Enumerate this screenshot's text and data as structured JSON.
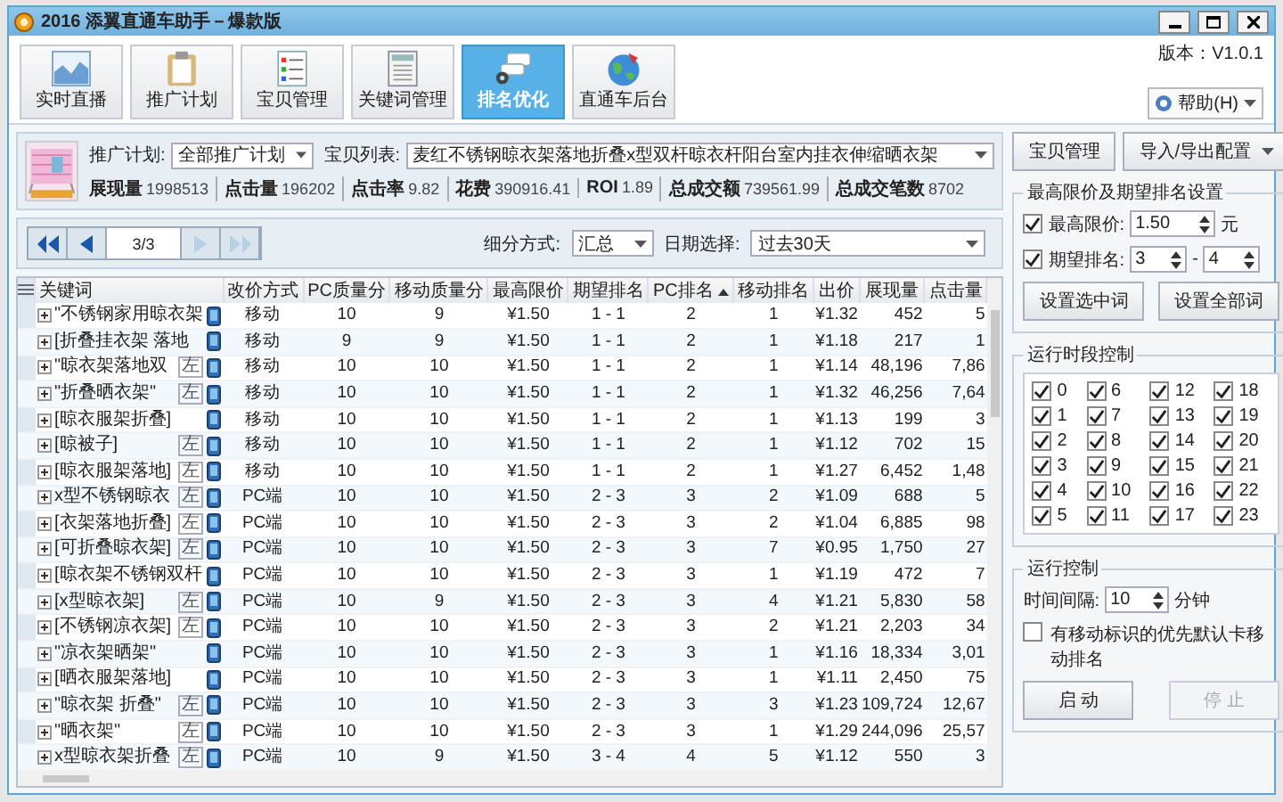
{
  "window": {
    "title": "2016 添翼直通车助手－爆款版",
    "version": "版本：V1.0.1",
    "help": "帮助(H)"
  },
  "toolbar": [
    {
      "label": "实时直播",
      "selected": false
    },
    {
      "label": "推广计划",
      "selected": false
    },
    {
      "label": "宝贝管理",
      "selected": false
    },
    {
      "label": "关键词管理",
      "selected": false
    },
    {
      "label": "排名优化",
      "selected": true
    },
    {
      "label": "直通车后台",
      "selected": false
    }
  ],
  "product": {
    "plan_label": "推广计划:",
    "plan": "全部推广计划",
    "item_label": "宝贝列表:",
    "item": "麦红不锈钢晾衣架落地折叠x型双杆晾衣杆阳台室内挂衣伸缩晒衣架",
    "stats": [
      {
        "label": "展现量",
        "value": "1998513"
      },
      {
        "label": "点击量",
        "value": "196202"
      },
      {
        "label": "点击率",
        "value": "9.82"
      },
      {
        "label": "花费",
        "value": "390916.41"
      },
      {
        "label": "ROI",
        "value": "1.89"
      },
      {
        "label": "总成交额",
        "value": "739561.99"
      },
      {
        "label": "总成交笔数",
        "value": "8702"
      }
    ]
  },
  "pager": {
    "page": "3/3",
    "buttons": [
      {
        "kind": "first",
        "disabled": false
      },
      {
        "kind": "prev",
        "disabled": false
      },
      {
        "kind": "next",
        "disabled": true
      },
      {
        "kind": "last",
        "disabled": true
      }
    ]
  },
  "filters": [
    {
      "label": "细分方式:",
      "value": "汇总"
    },
    {
      "label": "日期选择:",
      "value": "过去30天"
    }
  ],
  "table": {
    "columns": [
      {
        "label": "关键词",
        "sorted": false
      },
      {
        "label": "改价方式",
        "sorted": false
      },
      {
        "label": "PC质量分",
        "sorted": false
      },
      {
        "label": "移动质量分",
        "sorted": false
      },
      {
        "label": "最高限价",
        "sorted": false
      },
      {
        "label": "期望排名",
        "sorted": false
      },
      {
        "label": "PC排名",
        "sorted": true
      },
      {
        "label": "移动排名",
        "sorted": false
      },
      {
        "label": "出价",
        "sorted": false
      },
      {
        "label": "展现量",
        "sorted": false
      },
      {
        "label": "点击量",
        "sorted": false
      }
    ],
    "rows": [
      {
        "cells": [
          "\"不锈钢家用晾衣架",
          "移动",
          "10",
          "9",
          "¥1.50",
          "1 - 1",
          "2",
          "1",
          "¥1.32",
          "452",
          "5"
        ]
      },
      {
        "cells": [
          "[折叠挂衣架 落地",
          "移动",
          "9",
          "9",
          "¥1.50",
          "1 - 1",
          "2",
          "1",
          "¥1.18",
          "217",
          "1"
        ]
      },
      {
        "tag": "左",
        "cells": [
          "\"晾衣架落地双",
          "移动",
          "10",
          "10",
          "¥1.50",
          "1 - 1",
          "2",
          "1",
          "¥1.14",
          "48,196",
          "7,86"
        ]
      },
      {
        "tag": "左",
        "cells": [
          "\"折叠晒衣架\"",
          "移动",
          "10",
          "10",
          "¥1.50",
          "1 - 1",
          "2",
          "1",
          "¥1.32",
          "46,256",
          "7,64"
        ]
      },
      {
        "cells": [
          "[晾衣服架折叠]",
          "移动",
          "10",
          "10",
          "¥1.50",
          "1 - 1",
          "2",
          "1",
          "¥1.13",
          "199",
          "3"
        ]
      },
      {
        "tag": "左",
        "cells": [
          "[晾被子]",
          "移动",
          "10",
          "10",
          "¥1.50",
          "1 - 1",
          "2",
          "1",
          "¥1.12",
          "702",
          "15"
        ]
      },
      {
        "tag": "左",
        "cells": [
          "[晾衣服架落地]",
          "移动",
          "10",
          "10",
          "¥1.50",
          "1 - 1",
          "2",
          "1",
          "¥1.27",
          "6,452",
          "1,48"
        ]
      },
      {
        "tag": "左",
        "cells": [
          "x型不锈钢晾衣",
          "PC端",
          "10",
          "10",
          "¥1.50",
          "2 - 3",
          "3",
          "2",
          "¥1.09",
          "688",
          "5"
        ]
      },
      {
        "tag": "左",
        "cells": [
          "[衣架落地折叠]",
          "PC端",
          "10",
          "10",
          "¥1.50",
          "2 - 3",
          "3",
          "2",
          "¥1.04",
          "6,885",
          "98"
        ]
      },
      {
        "tag": "左",
        "cells": [
          "[可折叠晾衣架]",
          "PC端",
          "10",
          "10",
          "¥1.50",
          "2 - 3",
          "3",
          "7",
          "¥0.95",
          "1,750",
          "27"
        ]
      },
      {
        "cells": [
          "[晾衣架不锈钢双杆",
          "PC端",
          "10",
          "10",
          "¥1.50",
          "2 - 3",
          "3",
          "1",
          "¥1.19",
          "472",
          "7"
        ]
      },
      {
        "tag": "左",
        "cells": [
          "[x型晾衣架]",
          "PC端",
          "10",
          "9",
          "¥1.50",
          "2 - 3",
          "3",
          "4",
          "¥1.21",
          "5,830",
          "58"
        ]
      },
      {
        "tag": "左",
        "cells": [
          "[不锈钢凉衣架]",
          "PC端",
          "10",
          "10",
          "¥1.50",
          "2 - 3",
          "3",
          "2",
          "¥1.21",
          "2,203",
          "34"
        ]
      },
      {
        "cells": [
          "\"凉衣架晒架\"",
          "PC端",
          "10",
          "10",
          "¥1.50",
          "2 - 3",
          "3",
          "1",
          "¥1.16",
          "18,334",
          "3,01"
        ]
      },
      {
        "cells": [
          "[晒衣服架落地]",
          "PC端",
          "10",
          "10",
          "¥1.50",
          "2 - 3",
          "3",
          "1",
          "¥1.11",
          "2,450",
          "75"
        ]
      },
      {
        "tag": "左",
        "cells": [
          "\"晾衣架 折叠\"",
          "PC端",
          "10",
          "10",
          "¥1.50",
          "2 - 3",
          "3",
          "3",
          "¥1.23",
          "109,724",
          "12,67"
        ]
      },
      {
        "tag": "左",
        "cells": [
          "\"晒衣架\"",
          "PC端",
          "10",
          "10",
          "¥1.50",
          "2 - 3",
          "3",
          "1",
          "¥1.29",
          "244,096",
          "25,57"
        ]
      },
      {
        "tag": "左",
        "cells": [
          "x型晾衣架折叠",
          "PC端",
          "10",
          "9",
          "¥1.50",
          "3 - 4",
          "4",
          "5",
          "¥1.12",
          "550",
          "3"
        ]
      }
    ]
  },
  "side": {
    "item_manage": "宝贝管理",
    "import_export": "导入/导出配置",
    "limits": {
      "title": "最高限价及期望排名设置",
      "max_price": {
        "label": "最高限价:",
        "checked": true,
        "value": "1.50",
        "unit": "元"
      },
      "rank": {
        "label": "期望排名:",
        "checked": true,
        "from": "3",
        "sep": "-",
        "to": "4"
      },
      "buttons": [
        "设置选中词",
        "设置全部词"
      ]
    },
    "schedule": {
      "title": "运行时段控制",
      "hours": [
        {
          "label": "0",
          "checked": true
        },
        {
          "label": "1",
          "checked": true
        },
        {
          "label": "2",
          "checked": true
        },
        {
          "label": "3",
          "checked": true
        },
        {
          "label": "4",
          "checked": true
        },
        {
          "label": "5",
          "checked": true
        },
        {
          "label": "6",
          "checked": true
        },
        {
          "label": "7",
          "checked": true
        },
        {
          "label": "8",
          "checked": true
        },
        {
          "label": "9",
          "checked": true
        },
        {
          "label": "10",
          "checked": true
        },
        {
          "label": "11",
          "checked": true
        },
        {
          "label": "12",
          "checked": true
        },
        {
          "label": "13",
          "checked": true
        },
        {
          "label": "14",
          "checked": true
        },
        {
          "label": "15",
          "checked": true
        },
        {
          "label": "16",
          "checked": true
        },
        {
          "label": "17",
          "checked": true
        },
        {
          "label": "18",
          "checked": true
        },
        {
          "label": "19",
          "checked": true
        },
        {
          "label": "20",
          "checked": true
        },
        {
          "label": "21",
          "checked": true
        },
        {
          "label": "22",
          "checked": true
        },
        {
          "label": "23",
          "checked": true
        }
      ]
    },
    "run": {
      "title": "运行控制",
      "interval_label": "时间间隔:",
      "interval": "10",
      "unit": "分钟",
      "mobile_first": {
        "label": "有移动标识的优先默认卡移动排名",
        "checked": false
      },
      "buttons": [
        {
          "label": "启 动",
          "disabled": false
        },
        {
          "label": "停 止",
          "disabled": true
        }
      ]
    }
  }
}
